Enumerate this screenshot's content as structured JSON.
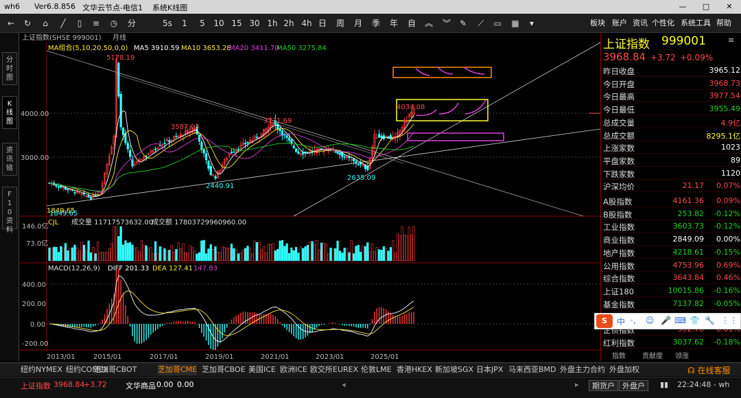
{
  "window": {
    "title": "wh6",
    "version": "Ver6.8.856",
    "server": "文华云节点-电信1",
    "chart_type": "系统K线图"
  },
  "toolbar": {
    "periods": [
      "分",
      "5s",
      "1",
      "5",
      "10",
      "15",
      "30",
      "1h",
      "2h",
      "4h",
      "日",
      "周",
      "月",
      "季",
      "年",
      "自"
    ],
    "right": [
      "板块",
      "账户",
      "资讯",
      "个性化",
      "系统工具",
      "帮助"
    ]
  },
  "left_tabs": [
    "分时图",
    "K线图",
    "资讯链",
    "F10资料"
  ],
  "chart_header": {
    "symbol": "上证指数(SHSE 999001)",
    "period": "月线"
  },
  "ma_legend": {
    "group": "MA组合(5,10,20,50,0,0)",
    "ma5": "MA5 3910.59",
    "ma10": "MA10 3653.28",
    "ma20": "MA20 3411.70",
    "ma50": "MA50 3275.84"
  },
  "price_labels": {
    "high_2015": "5178.19",
    "high_2018": "3587.03",
    "high_2021": "3731.69",
    "last_high": "4034.08",
    "low_2019": "2440.91",
    "low_2024": "2635.09",
    "low_2014": "1849.65",
    "low_2014_b": "1849.65"
  },
  "price_axis": [
    "4000.00",
    "3000.00"
  ],
  "vol_legend": {
    "label": "CJL",
    "vol": "成交量 11717573632.00",
    "amount": "成交额 17803729960960.00"
  },
  "vol_axis": [
    "146.0亿",
    "73.0亿"
  ],
  "macd_legend": {
    "label": "MACD(12,26,9)",
    "diff": "DIFF 201.33",
    "dea": "DEA 127.41",
    "macd": "147.83"
  },
  "macd_axis": [
    "400.00",
    "200.00",
    "0.00",
    "-200.00"
  ],
  "x_axis": [
    "2013/01",
    "2015/01",
    "2017/01",
    "2019/01",
    "2021/01",
    "2023/01",
    "2025/01"
  ],
  "quote": {
    "name": "上证指数",
    "code": "999001",
    "price": "3968.84",
    "change": "+3.72",
    "pct": "+0.09%"
  },
  "quote_rows": [
    {
      "label": "昨日收盘",
      "value": "3965.12",
      "color": "white"
    },
    {
      "label": "今日开盘",
      "value": "3968.73",
      "color": "red"
    },
    {
      "label": "今日最高",
      "value": "3977.54",
      "color": "red"
    },
    {
      "label": "今日最低",
      "value": "3955.49",
      "color": "green"
    },
    {
      "label": "总成交量",
      "value": "4.9亿",
      "color": "red"
    },
    {
      "label": "总成交额",
      "value": "8295.1亿",
      "color": "yellow"
    },
    {
      "label": "上涨家数",
      "value": "1023",
      "color": "white"
    },
    {
      "label": "平盘家数",
      "value": "89",
      "color": "white"
    },
    {
      "label": "下跌家数",
      "value": "1120",
      "color": "white"
    }
  ],
  "avg_row": {
    "label": "沪深均价",
    "value": "21.17",
    "pct": "0.07%"
  },
  "index_rows": [
    {
      "label": "A股指数",
      "value": "4161.36",
      "pct": "0.09%",
      "color": "red"
    },
    {
      "label": "B股指数",
      "value": "253.82",
      "pct": "-0.12%",
      "color": "green"
    },
    {
      "label": "工业指数",
      "value": "3603.73",
      "pct": "-0.12%",
      "color": "green"
    },
    {
      "label": "商业指数",
      "value": "2849.09",
      "pct": "0.00%",
      "color": "white"
    },
    {
      "label": "地产指数",
      "value": "4218.61",
      "pct": "-0.15%",
      "color": "green"
    },
    {
      "label": "公用指数",
      "value": "4753.96",
      "pct": "0.69%",
      "color": "red"
    },
    {
      "label": "综合指数",
      "value": "3643.84",
      "pct": "0.46%",
      "color": "red"
    },
    {
      "label": "上证180",
      "value": "10015.86",
      "pct": "-0.16%",
      "color": "green"
    },
    {
      "label": "基金指数",
      "value": "7137.82",
      "pct": "-0.05%",
      "color": "green"
    },
    {
      "label": "国债指数",
      "value": "",
      "pct": "",
      "color": "white"
    },
    {
      "label": "企债指数",
      "value": "302.78",
      "pct": "0.01%",
      "color": "red"
    },
    {
      "label": "红利指数",
      "value": "3037.62",
      "pct": "-0.18%",
      "color": "green"
    }
  ],
  "rpanel_tabs": [
    "指数",
    "贡献度",
    "领涨"
  ],
  "bottom_tabs": [
    "纽约NYMEX",
    "纽约COMEX",
    "芝加哥CBOT",
    "芝加哥CME",
    "芝加哥CBOE",
    "美国ICE",
    "欧洲ICE",
    "欧交所EUREX",
    "伦敦LME",
    "香港HKEX",
    "新加坡SGX",
    "日本JPX",
    "马来西亚BMD",
    "外盘主力合约",
    "外盘加权"
  ],
  "status": {
    "sh_label": "上证指数",
    "sh_price": "3968.84",
    "sh_change": "+3.72",
    "hk_label": "文华商品",
    "hk_price": "0.00",
    "hk_change": "0.00",
    "btn1": "期货户",
    "btn2": "外盘户",
    "time": "22:24:48 - wh",
    "service": "在线客服"
  },
  "ime": {
    "logo": "S",
    "items": [
      "中",
      "·,",
      "☺",
      "🎤",
      "⌨",
      "👕",
      "🔧",
      "⋮⋮"
    ]
  },
  "chart_data": {
    "type": "candlestick",
    "title": "上证指数(SHSE 999001) 月线",
    "ylim": [
      1600,
      5400
    ],
    "x_ticks": [
      "2013/01",
      "2015/01",
      "2017/01",
      "2019/01",
      "2021/01",
      "2023/01",
      "2025/01"
    ],
    "annotated_values": {
      "2015_high": 5178.19,
      "2018_high": 3587.03,
      "2019_low": 2440.91,
      "2021_high": 3731.69,
      "2024_low": 2635.09,
      "2025_high": 4034.08,
      "2014_low": 1849.65
    }
  }
}
